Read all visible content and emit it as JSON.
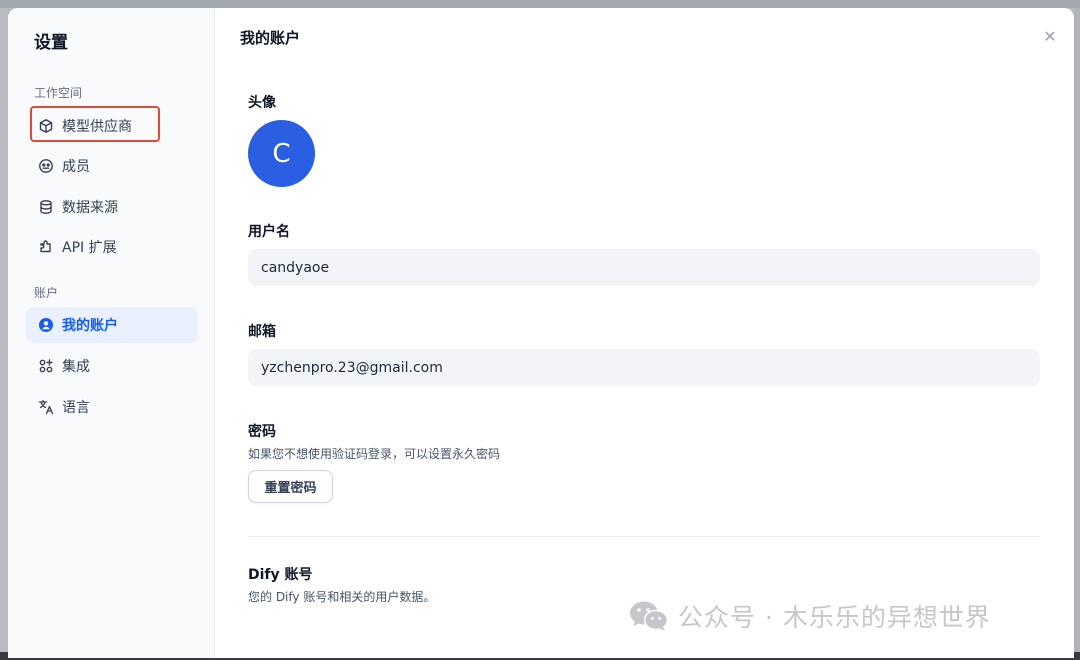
{
  "sidebar": {
    "title": "设置",
    "workspace_label": "工作空间",
    "account_label": "账户",
    "items": [
      {
        "label": "模型供应商",
        "icon": "cube-icon"
      },
      {
        "label": "成员",
        "icon": "members-icon"
      },
      {
        "label": "数据来源",
        "icon": "database-icon"
      },
      {
        "label": "API 扩展",
        "icon": "puzzle-icon"
      },
      {
        "label": "我的账户",
        "icon": "user-circle-icon",
        "active": true
      },
      {
        "label": "集成",
        "icon": "integration-icon"
      },
      {
        "label": "语言",
        "icon": "translate-icon"
      }
    ]
  },
  "main": {
    "title": "我的账户",
    "avatar_label": "头像",
    "avatar_letter": "C",
    "username_label": "用户名",
    "username_value": "candyaoe",
    "email_label": "邮箱",
    "email_value": "yzchenpro.23@gmail.com",
    "password_label": "密码",
    "password_help": "如果您不想使用验证码登录，可以设置永久密码",
    "reset_button": "重置密码",
    "dify_label": "Dify 账号",
    "dify_help": "您的 Dify 账号和相关的用户数据。"
  },
  "close_icon": "close-icon",
  "watermark": "公众号 · 木乐乐的异想世界",
  "colors": {
    "accent": "#155eef",
    "avatar_bg": "#2b5fe3",
    "highlight": "#e04a3a"
  }
}
